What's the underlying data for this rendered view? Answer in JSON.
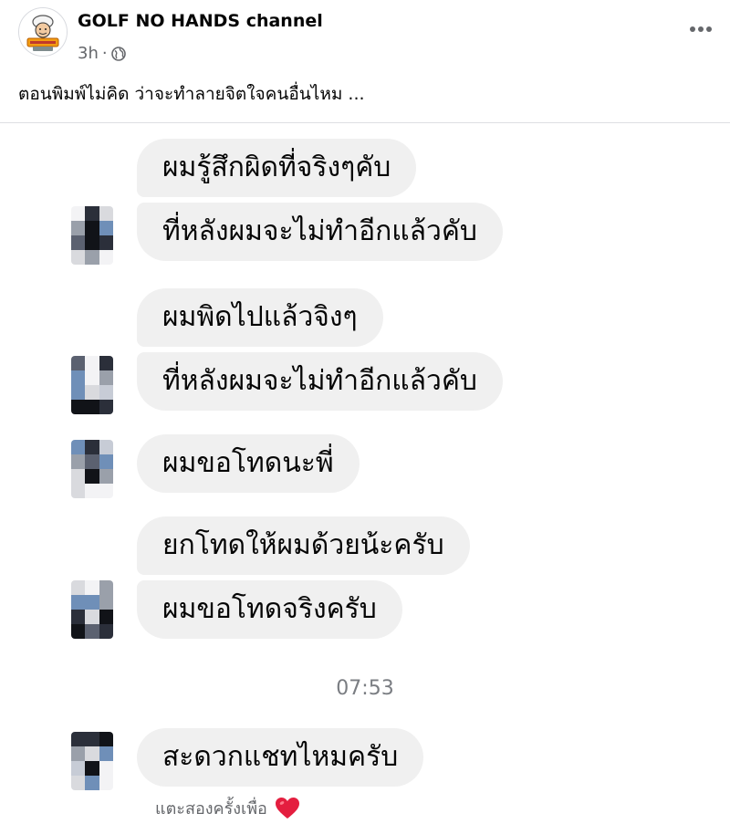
{
  "post": {
    "page_name": "GOLF NO HANDS channel",
    "time": "3h",
    "meta_separator": "·",
    "privacy_icon": "globe-icon",
    "more_icon": "more-options-icon",
    "caption": "ตอนพิมพ์ไม่คิด ว่าจะทำลายจิตใจคนอื่นไหม ..."
  },
  "chat": {
    "messages": [
      "ผมรู้สึกผิดที่จริงๆคับ",
      "ที่หลังผมจะไม่ทำอีกแล้วคับ",
      "ผมพิดไปแล้วจิงๆ",
      "ที่หลังผมจะไม่ทำอีกแล้วคับ",
      "ผมขอโทดนะพี่",
      "ยกโทดให้ผมด้วยน้ะครับ",
      "ผมขอโทดจริงครับ",
      "สะดวกแชทไหมครับ"
    ],
    "timestamp": "07:53",
    "reply_hint": "แตะสองครั้งเพื่อ",
    "heart_icon": "heart-icon"
  },
  "colors": {
    "bubble": "#f0f0f0",
    "secondary_text": "#65676b",
    "heart": "#e41e3f",
    "divider": "#dddfe2"
  }
}
